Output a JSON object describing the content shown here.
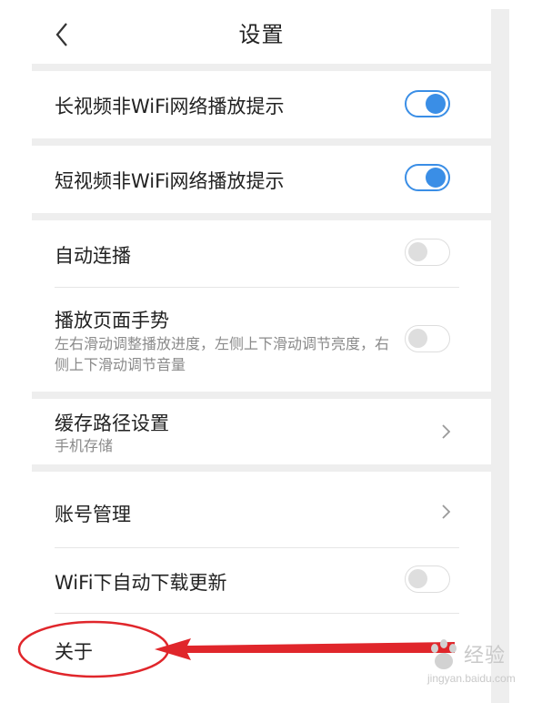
{
  "header": {
    "title": "设置"
  },
  "settings": {
    "long_video_wifi": {
      "label": "长视频非WiFi网络播放提示",
      "enabled": true
    },
    "short_video_wifi": {
      "label": "短视频非WiFi网络播放提示",
      "enabled": true
    },
    "autoplay": {
      "label": "自动连播",
      "enabled": false
    },
    "gesture": {
      "label": "播放页面手势",
      "description": "左右滑动调整播放进度，左侧上下滑动调节亮度，右侧上下滑动调节音量",
      "enabled": false
    },
    "cache_path": {
      "label": "缓存路径设置",
      "value": "手机存储"
    },
    "account": {
      "label": "账号管理"
    },
    "wifi_auto_update": {
      "label": "WiFi下自动下载更新",
      "enabled": false
    },
    "about": {
      "label": "关于"
    }
  },
  "colors": {
    "toggle_on": "#3a8ee6",
    "annotation": "#e0262b",
    "section_gap": "#eeeeee"
  },
  "watermark": {
    "brand": "Baidu",
    "text": "经验",
    "url": "jingyan.baidu.com"
  }
}
